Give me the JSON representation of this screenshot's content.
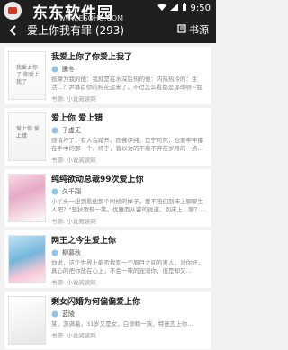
{
  "status_bar": {
    "time": "9:50",
    "watermark_title": "东东软件园",
    "watermark_sub": "www.ESOHU.COM",
    "icons": [
      "wifi-icon",
      "signal-icon",
      "battery-icon"
    ]
  },
  "header": {
    "title": "爱上你我有罪 (293)",
    "bookshelf_label": "书源",
    "back_icon": "back-arrow-icon",
    "book_icon": "bookshelf-icon"
  },
  "books": [
    {
      "title": "我爱上你了你爱上我了",
      "author": "騰冬",
      "desc": "按摩为我的他：我就是在水深后热的他：内热热冷的：生活...？尹慕首你的纯花运来了，不过怎么看都是那球啊~我说...",
      "source": "书源: 小说阅读网",
      "cover_text": "我爱上你了\n你爱上我了"
    },
    {
      "title": "爱上你 爱上错",
      "author": "子虚无",
      "desc": "感情坏了，有人会踏开，而佛伊纯，是宁可死，也要牢牢攥在手中的那一个。终于，曾以为的不离不弃在岁月的一点...",
      "source": "书源: 小说阅读网",
      "cover_text": "爱上你\n爱上错"
    },
    {
      "title": "纯纯欲动总裁99次爱上你",
      "author": "久千翔",
      "desc": "小丫头一想到看他那个时候的样子，要不咱们到床上聊聊生人吧？\"楚狄歌郁一笑，优雅而从容的说道。到床上...聊？...",
      "source": "书源: 小说阅读网",
      "cover_text": ""
    },
    {
      "title": "网王之今生爱上你",
      "author": "柳慕秋",
      "desc": "你说，这个世界上能否找到一个眉目之间的男人，对你好，真心的把你放在心上，不会一味的宠溺你，但是却又...",
      "source": "书源: 小说阅读网",
      "cover_text": ""
    },
    {
      "title": "剩女闪婚为何偏偏爱上你",
      "author": "蓝陵",
      "desc": "某，游满着。31岁又是女，白领精一族，特迷恋上你...",
      "source": "书源: 小说阅读网",
      "cover_text": ""
    }
  ]
}
